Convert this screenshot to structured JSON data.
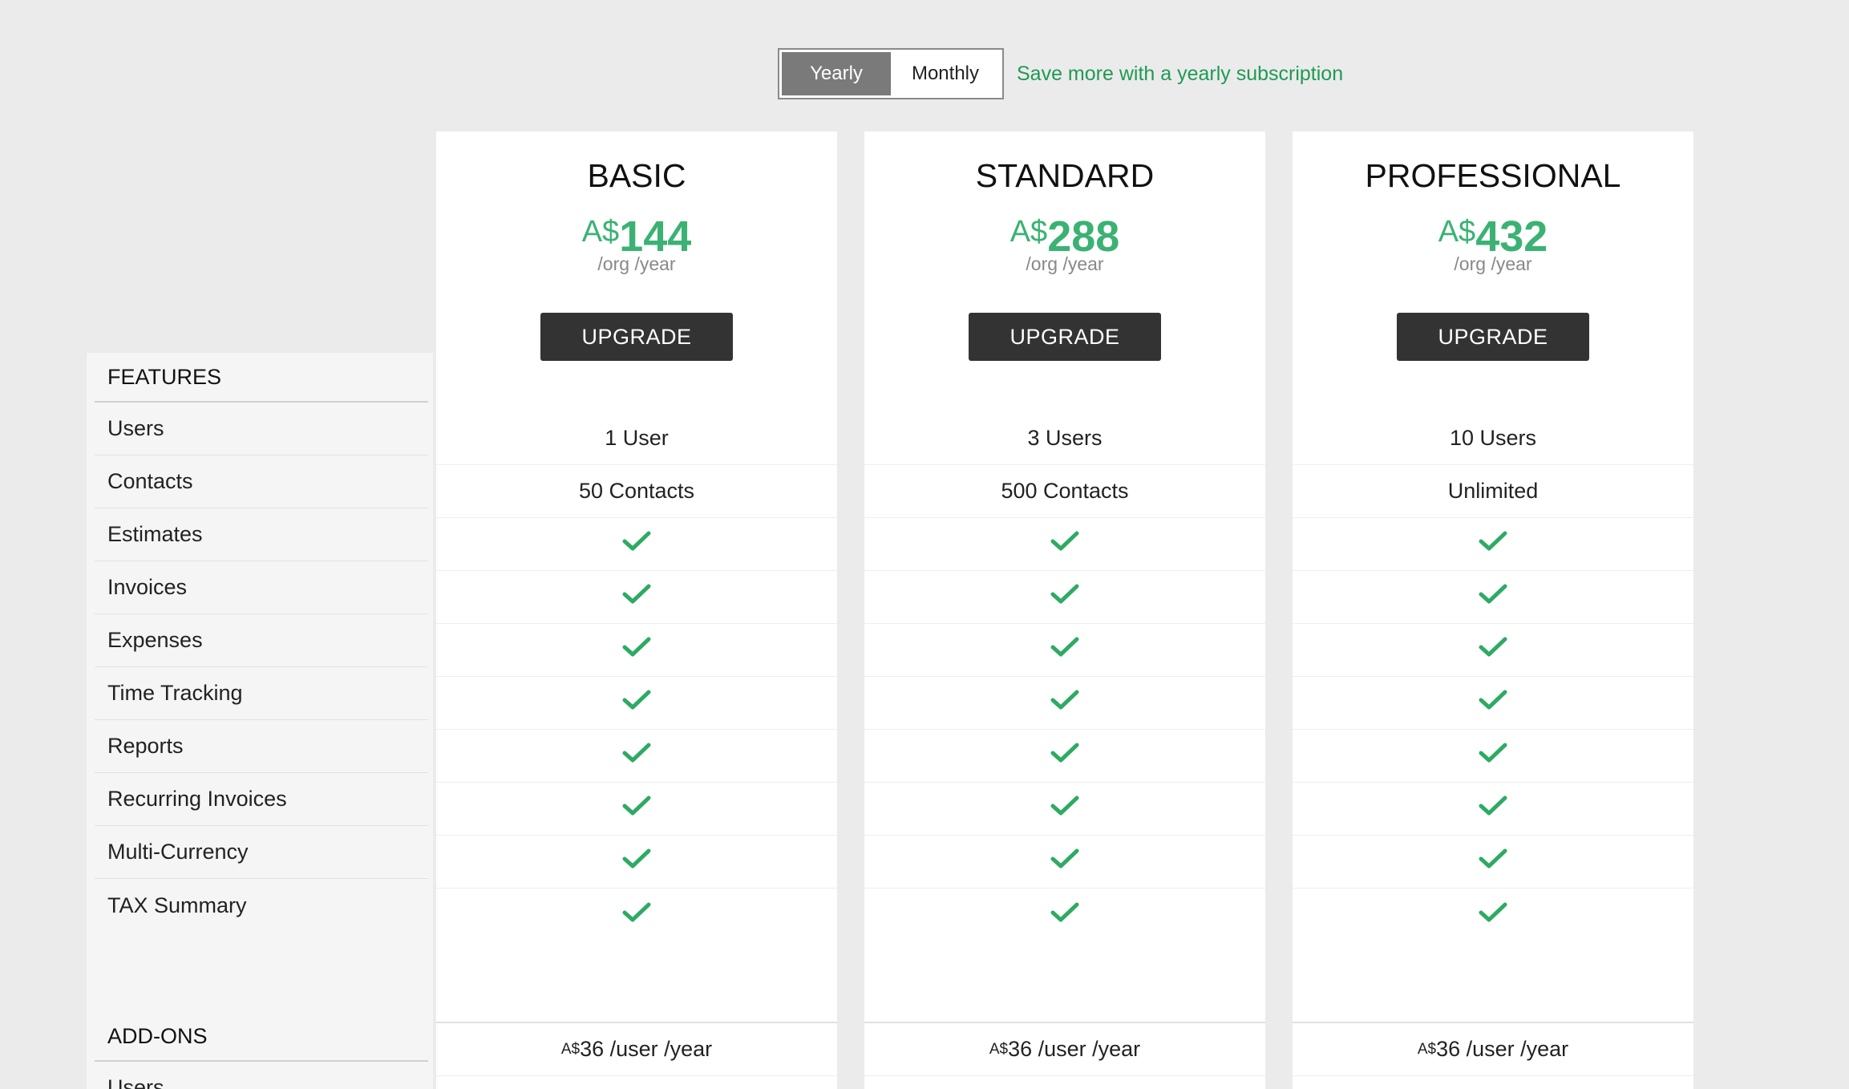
{
  "billing_toggle": {
    "yearly_label": "Yearly",
    "monthly_label": "Monthly",
    "selected": "Yearly",
    "promo_text": "Save more with a yearly subscription"
  },
  "features": {
    "section_title": "FEATURES",
    "items": [
      "Users",
      "Contacts",
      "Estimates",
      "Invoices",
      "Expenses",
      "Time Tracking",
      "Reports",
      "Recurring Invoices",
      "Multi-Currency",
      "TAX Summary"
    ]
  },
  "addons": {
    "section_title": "ADD-ONS",
    "items": [
      "Users"
    ]
  },
  "plans": [
    {
      "name": "BASIC",
      "currency": "A$",
      "price": "144",
      "period": "/org /year",
      "cta": "UPGRADE",
      "users": "1 User",
      "contacts": "50 Contacts",
      "addon_currency": "A$",
      "addon_price": "36",
      "addon_period": " /user /year"
    },
    {
      "name": "STANDARD",
      "currency": "A$",
      "price": "288",
      "period": "/org /year",
      "cta": "UPGRADE",
      "users": "3 Users",
      "contacts": "500 Contacts",
      "addon_currency": "A$",
      "addon_price": "36",
      "addon_period": " /user /year"
    },
    {
      "name": "PROFESSIONAL",
      "currency": "A$",
      "price": "432",
      "period": "/org /year",
      "cta": "UPGRADE",
      "users": "10 Users",
      "contacts": "Unlimited",
      "addon_currency": "A$",
      "addon_price": "36",
      "addon_period": " /user /year"
    }
  ],
  "icons": {
    "included": "check-icon"
  },
  "colors": {
    "accent_green": "#3bb273",
    "promo_green": "#1f9a55",
    "button_dark": "#333333",
    "toggle_active": "#7a7a7a"
  }
}
